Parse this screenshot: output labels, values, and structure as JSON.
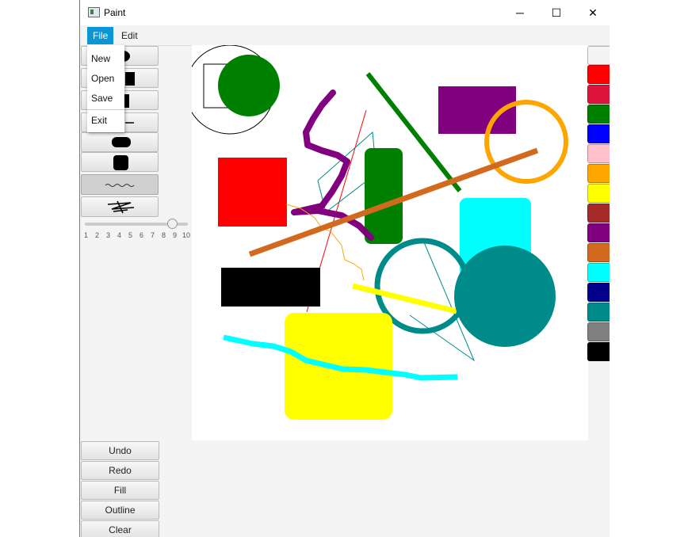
{
  "window": {
    "title": "Paint",
    "minimize_glyph": "─",
    "maximize_glyph": "☐",
    "close_glyph": "✕"
  },
  "menubar": {
    "items": [
      {
        "label": "File"
      },
      {
        "label": "Edit"
      }
    ]
  },
  "file_menu": {
    "items": [
      {
        "label": "New"
      },
      {
        "label": "Open"
      },
      {
        "label": "Save"
      },
      {
        "label": "Exit"
      }
    ]
  },
  "tools": [
    {
      "name": "ellipse-tool-button",
      "icon": "ellipse-icon"
    },
    {
      "name": "rectangle-tool-button",
      "icon": "rectangle-icon"
    },
    {
      "name": "filled-rectangle-tool-button",
      "icon": "tall-rectangle-icon"
    },
    {
      "name": "line-tool-button",
      "icon": "line-icon"
    },
    {
      "name": "rounded-rect-tool-button",
      "icon": "rounded-rectangle-icon"
    },
    {
      "name": "rounded-square-tool-button",
      "icon": "rounded-square-icon"
    },
    {
      "name": "freehand-tool-button",
      "icon": "squiggle-icon",
      "selected": true
    },
    {
      "name": "eraser-tool-button",
      "icon": "scribble-icon"
    }
  ],
  "stroke_slider": {
    "min": 1,
    "max": 10,
    "value": 8,
    "ticks": [
      "1",
      "2",
      "3",
      "4",
      "5",
      "6",
      "7",
      "8",
      "9",
      "10"
    ]
  },
  "palette": [
    "#f4f4f4",
    "#ff0000",
    "#dc143c",
    "#008000",
    "#0000ff",
    "#ffc0cb",
    "#ffa500",
    "#ffff00",
    "#a52a2a",
    "#800080",
    "#d2691e",
    "#00ffff",
    "#00008b",
    "#008b8b",
    "#808080",
    "#000000"
  ],
  "actions": [
    {
      "label": "Undo"
    },
    {
      "label": "Redo"
    },
    {
      "label": "Fill"
    },
    {
      "label": "Outline"
    },
    {
      "label": "Clear"
    }
  ]
}
